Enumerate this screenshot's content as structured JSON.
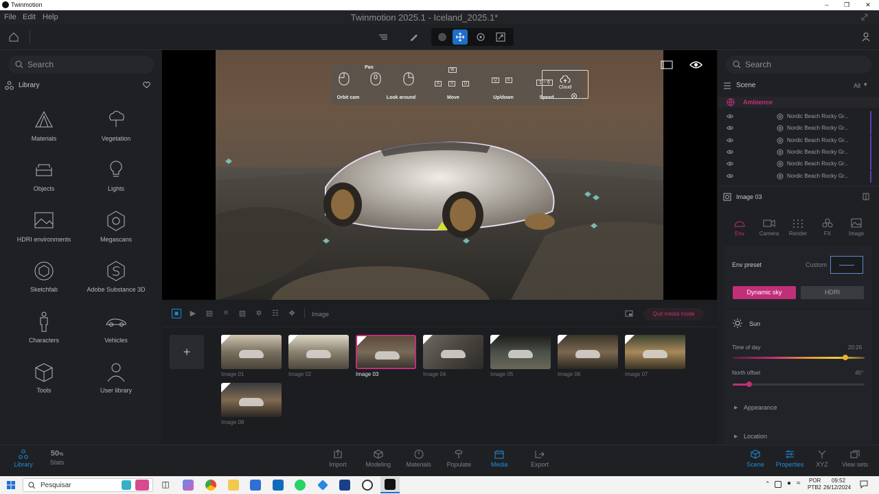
{
  "os_window": {
    "title": "Twinmotion"
  },
  "menu": [
    "File",
    "Edit",
    "Help"
  ],
  "app_title": "Twinmotion 2025.1 - Iceland_2025.1*",
  "library": {
    "search_placeholder": "Search",
    "title": "Library",
    "items": [
      {
        "label": "Materials",
        "icon": "materials-icon"
      },
      {
        "label": "Vegetation",
        "icon": "tree-icon"
      },
      {
        "label": "Objects",
        "icon": "sofa-icon"
      },
      {
        "label": "Lights",
        "icon": "bulb-icon"
      },
      {
        "label": "HDRI environments",
        "icon": "hdri-icon"
      },
      {
        "label": "Megascans",
        "icon": "megascans-icon"
      },
      {
        "label": "Sketchfab",
        "icon": "sketchfab-icon"
      },
      {
        "label": "Adobe Substance 3D",
        "icon": "substance-icon"
      },
      {
        "label": "Characters",
        "icon": "person-icon"
      },
      {
        "label": "Vehicles",
        "icon": "car-icon"
      },
      {
        "label": "Tools",
        "icon": "tools-icon"
      },
      {
        "label": "User library",
        "icon": "user-library-icon"
      }
    ]
  },
  "nav_hud": {
    "pan": "Pan",
    "orbit": "Orbit cam",
    "look": "Look around",
    "move": "Move",
    "updown": "Up/down",
    "speed": "Speed",
    "speed_keys": "1 ~ 6",
    "cloud": "Cloud",
    "keys_move": [
      "W",
      "A",
      "S",
      "D"
    ],
    "keys_updown": [
      "Q",
      "E"
    ]
  },
  "media": {
    "mode_label": "Image",
    "quit_label": "Quit media mode",
    "thumbnails": [
      {
        "label": "Image 01",
        "active": false
      },
      {
        "label": "Image 02",
        "active": false
      },
      {
        "label": "Image 03",
        "active": true
      },
      {
        "label": "Image 04",
        "active": false
      },
      {
        "label": "Image 05",
        "active": false
      },
      {
        "label": "Image 06",
        "active": false
      },
      {
        "label": "Image 07",
        "active": false
      },
      {
        "label": "Image 08",
        "active": false
      }
    ]
  },
  "scene_panel": {
    "search_placeholder": "Search",
    "title": "Scene",
    "filter": "All",
    "group": "Ambience",
    "rows": [
      "Nordic Beach Rocky Gr...",
      "Nordic Beach Rocky Gr...",
      "Nordic Beach Rocky Gr...",
      "Nordic Beach Rocky Gr...",
      "Nordic Beach Rocky Gr...",
      "Nordic Beach Rocky Gr..."
    ]
  },
  "properties": {
    "selected": "Image 03",
    "tabs": [
      "Env",
      "Camera",
      "Render",
      "FX",
      "Image"
    ],
    "env_preset_label": "Env preset",
    "env_preset_value": "Custom",
    "dynamic_sky": "Dynamic sky",
    "hdri": "HDRI",
    "sun_label": "Sun",
    "time_label": "Time of day",
    "time_value": "20:26",
    "time_fraction": 0.852,
    "north_label": "North offset",
    "north_value": "45°",
    "north_fraction": 0.125,
    "appearance": "Appearance",
    "location": "Location"
  },
  "bottom_left": [
    {
      "label": "Library"
    },
    {
      "value": "50",
      "unit": "%",
      "label": "Stats"
    }
  ],
  "bottom_center": [
    "Import",
    "Modeling",
    "Materials",
    "Populate",
    "Media",
    "Export"
  ],
  "bottom_right": [
    "Scene",
    "Properties",
    "XYZ",
    "View sets"
  ],
  "taskbar": {
    "search": "Pesquisar",
    "lang1": "POR",
    "lang2": "PTB2",
    "time": "09:52",
    "date": "26/12/2024"
  },
  "colors": {
    "accent": "#c22f79",
    "blue": "#1e8fe0"
  }
}
